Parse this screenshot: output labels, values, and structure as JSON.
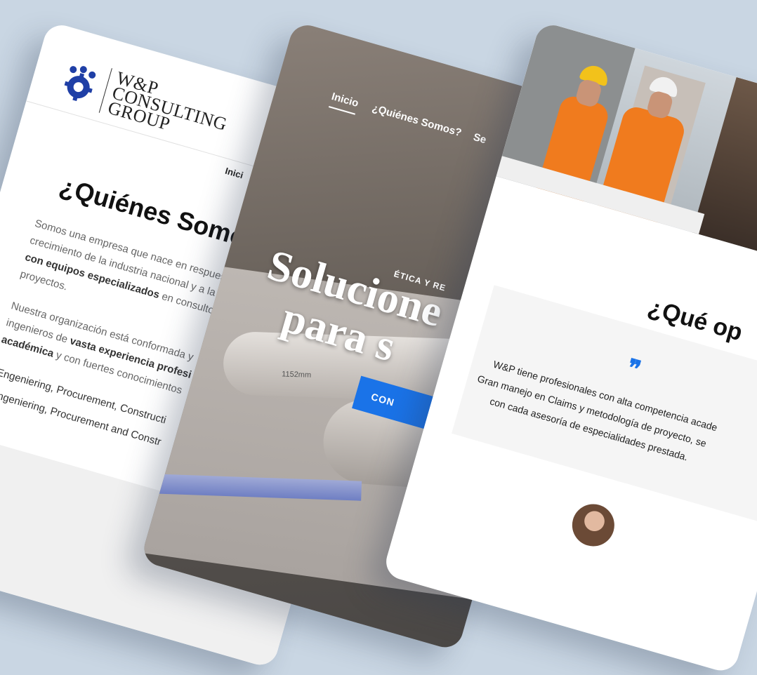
{
  "about_card": {
    "logo_text_line1": "W&P",
    "logo_text_line2": "CONSULTING",
    "logo_text_line3": "GROUP",
    "nav_item": "Inici",
    "heading": "¿Quiénes Somos",
    "para1_a": "Somos una empresa que nace en respues",
    "para1_b": "crecimiento de la industria nacional y a la",
    "para1_c_bold": "con equipos especializados",
    "para1_c": " en consulto",
    "para1_d": "proyectos.",
    "para2_a": "Nuestra organización está conformada y",
    "para2_b": "ingenieros de ",
    "para2_b_bold": "vasta experiencia profesi",
    "para2_c_bold": "académica",
    "para2_c": " y con fuertes conocimientos",
    "check1": "Engeniering, Procurement, Constructi",
    "check2": "Engeniering, Procurement and Constr"
  },
  "hero_card": {
    "nav": [
      "Inicio",
      "¿Quiénes Somos?",
      "Se"
    ],
    "kicker": "ÉTICA Y RE",
    "headline_line1": "Solucione",
    "headline_line2": "para s",
    "cta": "CON",
    "dimension_label": "1152mm"
  },
  "services_card": {
    "heading": "¿Qué op",
    "quote_icon": "❞",
    "quote_line1": "W&P tiene profesionales con alta competencia acade",
    "quote_line2": "Gran manejo en Claims y metodología de proyecto, se",
    "quote_line3": "con cada asesoría de especialidades prestada."
  },
  "colors": {
    "accent": "#1a73e8",
    "background": "#c9d6e3",
    "logo_blue": "#1f3fa6"
  }
}
